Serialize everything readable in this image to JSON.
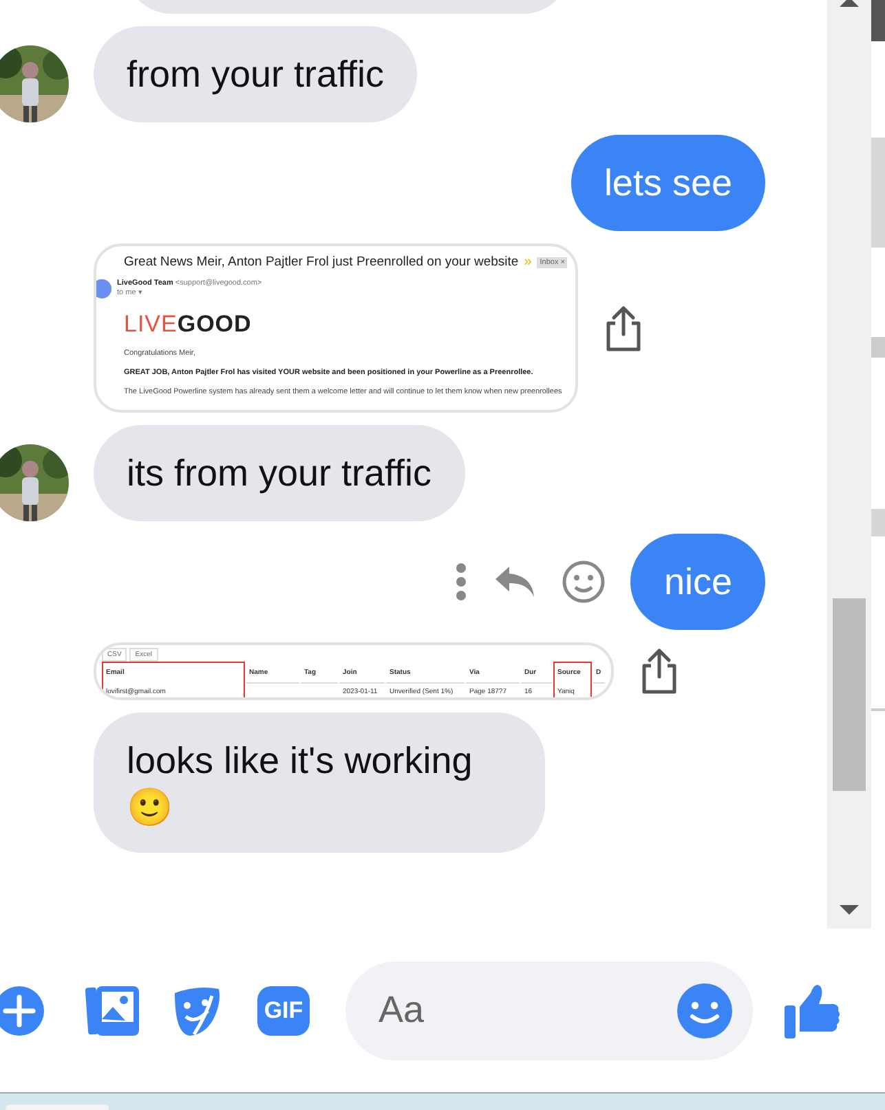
{
  "messages": [
    {
      "kind": "cut",
      "outgoing": false
    },
    {
      "kind": "text",
      "outgoing": false,
      "avatar": true,
      "text": "from your traffic"
    },
    {
      "kind": "text",
      "outgoing": true,
      "text": "lets see"
    },
    {
      "kind": "email",
      "outgoing": false,
      "share": true,
      "email": {
        "subject": "Great News Meir, Anton Pajtler Frol just Preenrolled on your website",
        "marker": "»",
        "badge": "Inbox ×",
        "sender": "LiveGood Team",
        "address": "<support@livegood.com>",
        "to": "to me ▾",
        "logo_left": "LIVE",
        "logo_right": "GOOD",
        "greeting": "Congratulations Meir,",
        "headline": "GREAT JOB, Anton Pajtler Frol has visited YOUR website and been positioned in your Powerline as a Preenrollee.",
        "body": "The LiveGood Powerline system has already sent them a welcome letter and will continue to let them know when new preenrollees"
      }
    },
    {
      "kind": "text",
      "outgoing": false,
      "avatar": true,
      "text": "its from your traffic"
    },
    {
      "kind": "text",
      "outgoing": true,
      "actions": true,
      "text": "nice"
    },
    {
      "kind": "table",
      "outgoing": false,
      "share": true,
      "table": {
        "buttons": [
          "CSV",
          "Excel"
        ],
        "columns": [
          {
            "label": "Email",
            "highlighted": true,
            "cell": "lovifirst@gmail.com"
          },
          {
            "label": "Name",
            "highlighted": false
          },
          {
            "label": "Tag",
            "highlighted": false
          },
          {
            "label": "Join",
            "highlighted": false,
            "cell": "2023-01-11"
          },
          {
            "label": "Status",
            "highlighted": false,
            "cell": "Unverified (Sent 1%)"
          },
          {
            "label": "Via",
            "highlighted": false,
            "cell": "Page 187?7"
          },
          {
            "label": "Dur",
            "highlighted": false,
            "cell": "16"
          },
          {
            "label": "Source",
            "highlighted": true,
            "cell": "Yaniq"
          },
          {
            "label": "D",
            "highlighted": false
          }
        ]
      }
    },
    {
      "kind": "text",
      "outgoing": false,
      "avatar": false,
      "text": "looks like it's working 🙂"
    }
  ],
  "composer": {
    "gif": "GIF",
    "placeholder": "Aa"
  }
}
